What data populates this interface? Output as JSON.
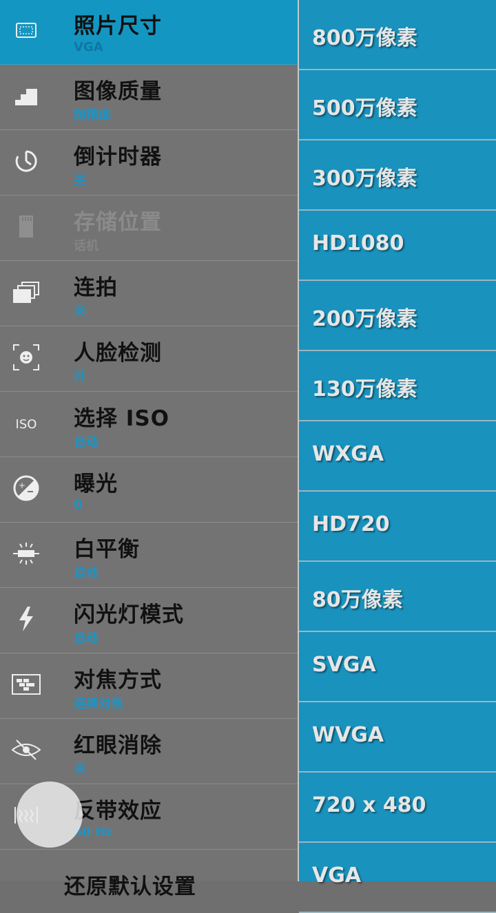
{
  "settings": {
    "items": [
      {
        "title": "照片尺寸",
        "value": "VGA",
        "icon": "photo-size-icon"
      },
      {
        "title": "图像质量",
        "value": "超精细",
        "icon": "image-quality-icon"
      },
      {
        "title": "倒计时器",
        "value": "关",
        "icon": "countdown-timer-icon"
      },
      {
        "title": "存储位置",
        "value": "话机",
        "icon": "sd-card-icon"
      },
      {
        "title": "连拍",
        "value": "关",
        "icon": "burst-icon"
      },
      {
        "title": "人脸检测",
        "value": "开",
        "icon": "face-detect-icon"
      },
      {
        "title": "选择 ISO",
        "value": "自动",
        "icon": "iso-icon"
      },
      {
        "title": "曝光",
        "value": "0",
        "icon": "exposure-icon"
      },
      {
        "title": "白平衡",
        "value": "自动",
        "icon": "white-balance-icon"
      },
      {
        "title": "闪光灯模式",
        "value": "自动",
        "icon": "flash-icon"
      },
      {
        "title": "对焦方式",
        "value": "连续对焦",
        "icon": "focus-mode-icon"
      },
      {
        "title": "红眼消除",
        "value": "关",
        "icon": "red-eye-icon"
      },
      {
        "title": "反带效应",
        "value": "50 Hz",
        "icon": "antibanding-icon"
      }
    ],
    "reset_label": "还原默认设置"
  },
  "sizes": {
    "options": [
      "800万像素",
      "500万像素",
      "300万像素",
      "HD1080",
      "200万像素",
      "130万像素",
      "WXGA",
      "HD720",
      "80万像素",
      "SVGA",
      "WVGA",
      "720 x 480",
      "VGA"
    ]
  },
  "colors": {
    "accent": "#1496c2",
    "value_text": "#1f93c4"
  }
}
